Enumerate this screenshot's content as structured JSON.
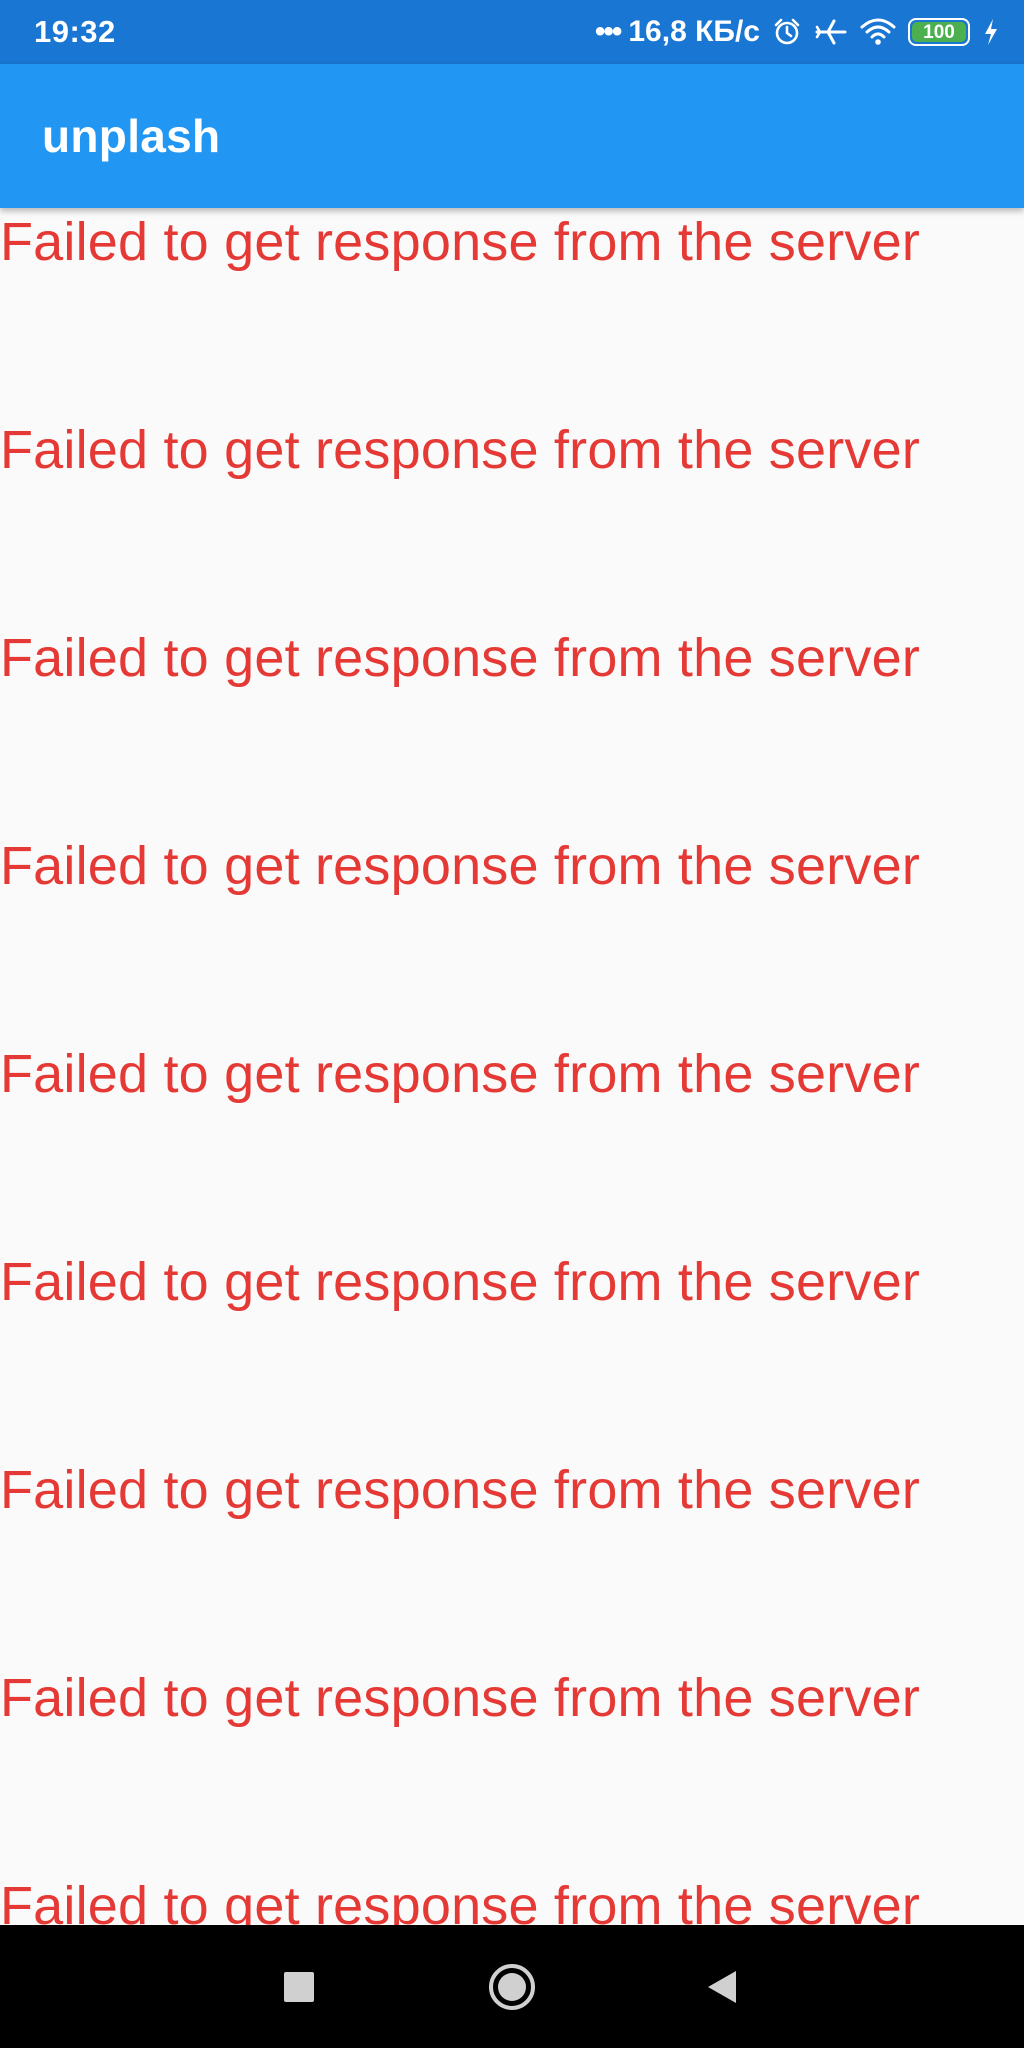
{
  "status_bar": {
    "time": "19:32",
    "dots": "•••",
    "network_speed": "16,8 КБ/с",
    "battery_level": "100",
    "battery_fill_fraction": 1.0,
    "icons": [
      "alarm-icon",
      "airplane-mode-icon",
      "wifi-icon",
      "battery-icon",
      "charging-icon"
    ],
    "battery_color": "#4caf50"
  },
  "app_bar": {
    "title": "unplash",
    "color": "#2196f3"
  },
  "content": {
    "messages": [
      "Failed to get response from the server",
      "Failed to get response from the server",
      "Failed to get response from the server",
      "Failed to get response from the server",
      "Failed to get response from the server",
      "Failed to get response from the server",
      "Failed to get response from the server",
      "Failed to get response from the server",
      "Failed to get response from the server"
    ],
    "message_color": "#e53935"
  },
  "nav_bar": {
    "icons": [
      "recents-square-icon",
      "home-circle-icon",
      "back-triangle-icon"
    ]
  }
}
